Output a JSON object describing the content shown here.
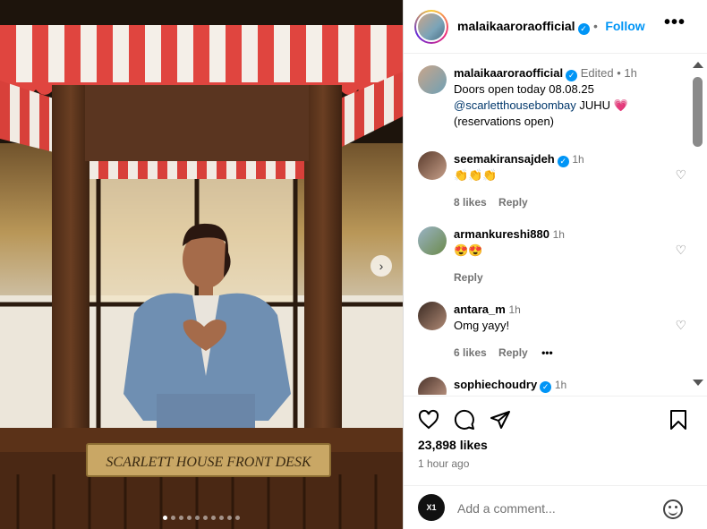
{
  "header": {
    "username": "malaikaaroraofficial",
    "follow_label": "Follow",
    "more_label": "•••"
  },
  "photo": {
    "sign_text": "SCARLETT HOUSE FRONT DESK",
    "dot_count": 10,
    "active_dot": 0,
    "next_glyph": "›"
  },
  "caption": {
    "username": "malaikaaroraofficial",
    "edited": "Edited",
    "time": "1h",
    "line1": "Doors open today  08.08.25",
    "mention": "@scarletthousebombay",
    "line2_tail": " JUHU 💗",
    "line3": "(reservations open)"
  },
  "comments": [
    {
      "username": "seemakiransajdeh",
      "verified": true,
      "time": "1h",
      "text": "👏👏👏",
      "likes": "8 likes",
      "reply": "Reply"
    },
    {
      "username": "armankureshi880",
      "verified": false,
      "time": "1h",
      "text": "😍😍",
      "likes": "",
      "reply": "Reply"
    },
    {
      "username": "antara_m",
      "verified": false,
      "time": "1h",
      "text": "Omg yayy!",
      "likes": "6 likes",
      "reply": "Reply",
      "more": "•••"
    },
    {
      "username": "sophiechoudry",
      "verified": true,
      "time": "1h",
      "text": "",
      "likes": "",
      "reply": ""
    }
  ],
  "post": {
    "likes": "23,898 likes",
    "time_ago": "1 hour ago"
  },
  "add_comment": {
    "placeholder": "Add a comment...",
    "avatar_text": "X1"
  },
  "colors": {
    "accent": "#0095f6",
    "secondary_text": "#737373",
    "awning_red": "#e0453f"
  }
}
